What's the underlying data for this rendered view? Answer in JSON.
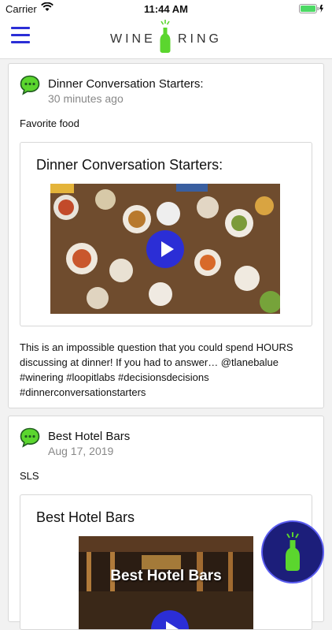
{
  "status_bar": {
    "carrier": "Carrier",
    "time": "11:44 AM"
  },
  "header": {
    "logo_left": "WINE",
    "logo_right": "RING"
  },
  "posts": [
    {
      "title": "Dinner Conversation Starters:",
      "time": "30 minutes ago",
      "caption": "Favorite food",
      "embed_title": "Dinner Conversation Starters:",
      "description": "This is an impossible question that you could spend HOURS discussing at dinner! If you had to answer… @tlanebalue #winering #loopitlabs #decisionsdecisions #dinnerconversationstarters"
    },
    {
      "title": "Best Hotel Bars",
      "time": "Aug 17, 2019",
      "caption": "SLS",
      "embed_title": "Best Hotel Bars",
      "image_text": "Best Hotel Bars"
    }
  ],
  "colors": {
    "accent": "#2b2ed6",
    "brand_green": "#5bd62e"
  }
}
